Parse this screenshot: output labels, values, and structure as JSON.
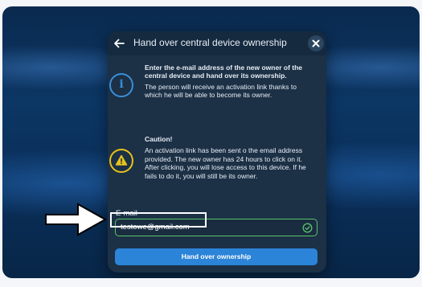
{
  "modal": {
    "title": "Hand over central device ownership",
    "info": {
      "heading": "Enter the e-mail address of the new owner of the central device and hand over its ownership.",
      "body": "The person will receive an activation link thanks to which he will be able to become its owner."
    },
    "caution": {
      "heading": "Caution!",
      "body": "An activation link has been sent o the email address provided. The new owner has 24 hours to click on it. After clicking, you will lose access to this device. If he fails to do it, you will still be its owner."
    },
    "email": {
      "label": "E-mail",
      "value": "testowe@gmail.com"
    },
    "submit_label": "Hand over ownership"
  },
  "icons": {
    "back": "arrow-left-icon",
    "close": "close-icon",
    "info": "info-icon",
    "warning": "warning-icon",
    "check": "check-circle-icon",
    "pointer": "arrow-right-annotation"
  },
  "colors": {
    "accent": "#2b84d8",
    "success": "#57c46a",
    "warning": "#e6c31a",
    "panel": "#1c3046"
  }
}
